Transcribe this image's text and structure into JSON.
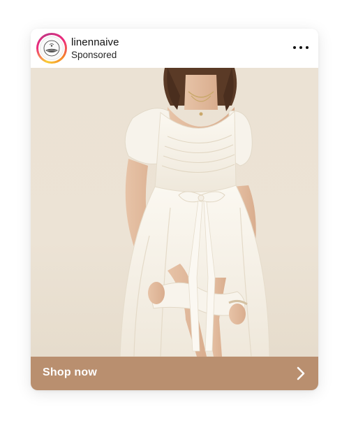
{
  "post": {
    "username": "linennaive",
    "subtitle": "Sponsored",
    "image_alt": "woman-in-white-linen-dress",
    "cta_label": "Shop now"
  },
  "icons": {
    "more": "more-options-icon",
    "chevron": "chevron-right-icon",
    "logo": "linennaive-logo-icon"
  },
  "colors": {
    "cta_background": "#b98f6f",
    "photo_background": "#ebe2d4",
    "story_ring_start": "#f9ce34",
    "story_ring_end": "#ee2a7b"
  }
}
